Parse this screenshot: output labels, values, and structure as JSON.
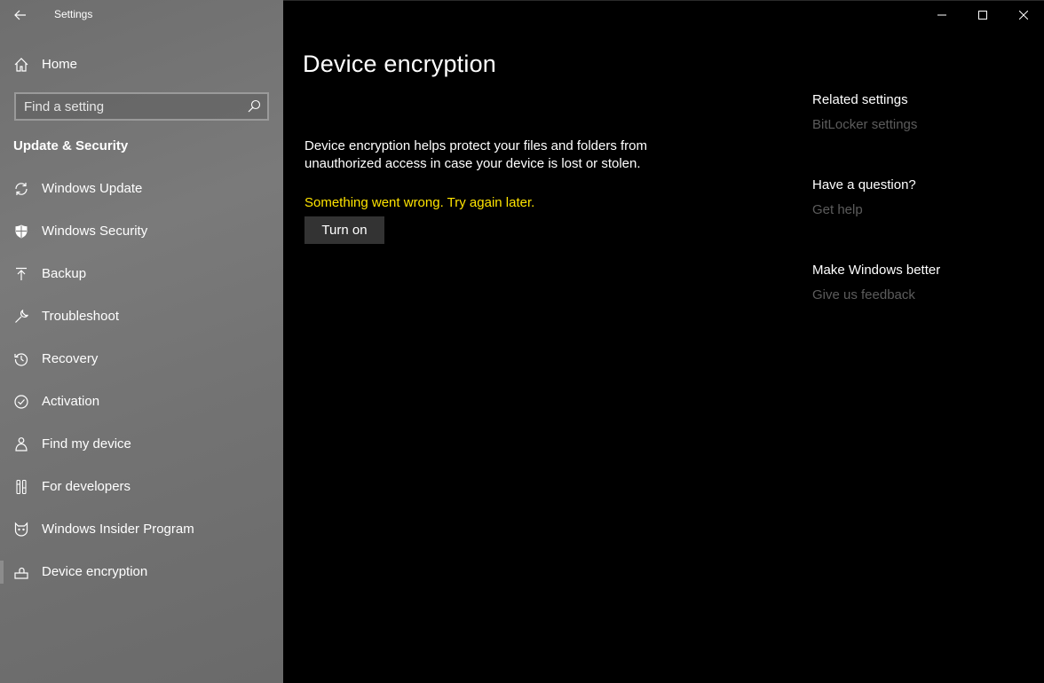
{
  "app": {
    "title": "Settings"
  },
  "sidebar": {
    "home_label": "Home",
    "search_placeholder": "Find a setting",
    "section_title": "Update & Security",
    "items": [
      {
        "label": "Windows Update",
        "icon": "refresh-icon"
      },
      {
        "label": "Windows Security",
        "icon": "shield-icon"
      },
      {
        "label": "Backup",
        "icon": "upload-icon"
      },
      {
        "label": "Troubleshoot",
        "icon": "wrench-icon"
      },
      {
        "label": "Recovery",
        "icon": "history-icon"
      },
      {
        "label": "Activation",
        "icon": "check-circle-icon"
      },
      {
        "label": "Find my device",
        "icon": "person-pin-icon"
      },
      {
        "label": "For developers",
        "icon": "developer-tools-icon"
      },
      {
        "label": "Windows Insider Program",
        "icon": "insider-cat-icon"
      },
      {
        "label": "Device encryption",
        "icon": "encryption-drive-icon",
        "active": true
      }
    ]
  },
  "main": {
    "title": "Device encryption",
    "description": "Device encryption helps protect your files and folders from unauthorized access in case your device is lost or stolen.",
    "error": "Something went wrong. Try again later.",
    "button_label": "Turn on"
  },
  "aside": {
    "related_heading": "Related settings",
    "related_link": "BitLocker settings",
    "question_heading": "Have a question?",
    "question_link": "Get help",
    "feedback_heading": "Make Windows better",
    "feedback_link": "Give us feedback"
  },
  "colors": {
    "error": "#ffe400",
    "link_disabled": "#5c5c5c",
    "button_bg": "#333333"
  }
}
